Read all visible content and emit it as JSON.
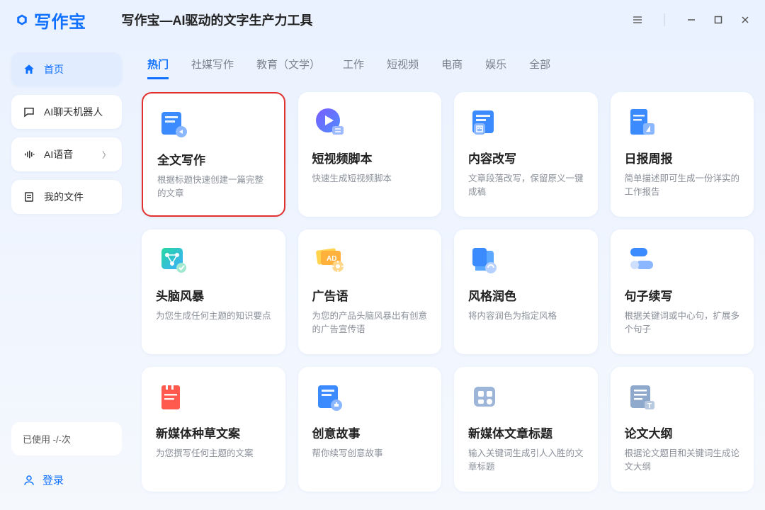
{
  "brand": "写作宝",
  "page_title": "写作宝—AI驱动的文字生产力工具",
  "sidebar": {
    "items": [
      {
        "label": "首页",
        "icon": "home-icon",
        "active": true
      },
      {
        "label": "AI聊天机器人",
        "icon": "chat-icon"
      },
      {
        "label": "AI语音",
        "icon": "voice-icon",
        "chevron": true
      },
      {
        "label": "我的文件",
        "icon": "file-icon"
      }
    ],
    "usage": "已使用 -/-次",
    "login": "登录"
  },
  "tabs": [
    "热门",
    "社媒写作",
    "教育（文学）",
    "工作",
    "短视频",
    "电商",
    "娱乐",
    "全部"
  ],
  "active_tab": 0,
  "cards": [
    {
      "title": "全文写作",
      "desc": "根据标题快速创建一篇完整的文章",
      "highlight": true,
      "icon": "doc"
    },
    {
      "title": "短视频脚本",
      "desc": "快速生成短视频脚本",
      "icon": "video"
    },
    {
      "title": "内容改写",
      "desc": "文章段落改写，保留原义一键成稿",
      "icon": "rewrite"
    },
    {
      "title": "日报周报",
      "desc": "简单描述即可生成一份详实的工作报告",
      "icon": "report"
    },
    {
      "title": "头脑风暴",
      "desc": "为您生成任何主题的知识要点",
      "icon": "brain"
    },
    {
      "title": "广告语",
      "desc": "为您的产品头脑风暴出有创意的广告宣传语",
      "icon": "ad"
    },
    {
      "title": "风格润色",
      "desc": "将内容润色为指定风格",
      "icon": "style"
    },
    {
      "title": "句子续写",
      "desc": "根据关键词或中心句，扩展多个句子",
      "icon": "continue"
    },
    {
      "title": "新媒体种草文案",
      "desc": "为您撰写任何主题的文案",
      "icon": "media"
    },
    {
      "title": "创意故事",
      "desc": "帮你续写创意故事",
      "icon": "story"
    },
    {
      "title": "新媒体文章标题",
      "desc": "输入关键词生成引人入胜的文章标题",
      "icon": "headline"
    },
    {
      "title": "论文大纲",
      "desc": "根据论文题目和关键词生成论文大纲",
      "icon": "outline"
    }
  ]
}
